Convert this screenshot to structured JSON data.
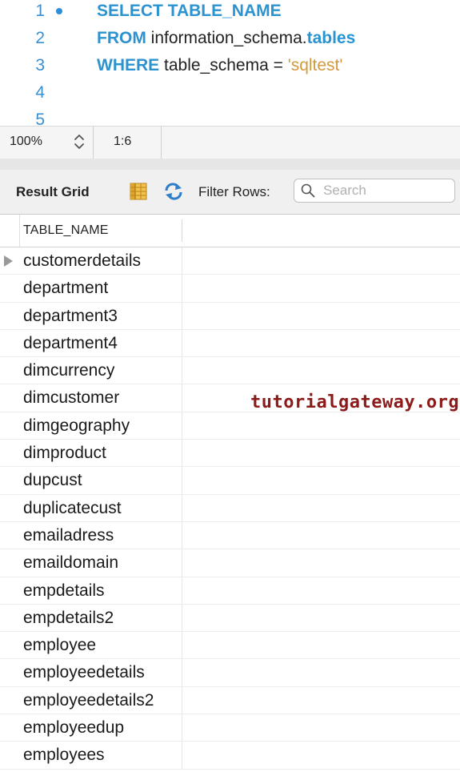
{
  "editor": {
    "lines": [
      {
        "number": "1",
        "keyword": "SELECT",
        "rest": " TABLE_NAME",
        "has_marker": true
      },
      {
        "number": "2",
        "keyword": "FROM",
        "rest": " information_schema.",
        "tail_keyword": "tables"
      },
      {
        "number": "3",
        "keyword": "WHERE",
        "rest": " table_schema = ",
        "string": "'sqltest'"
      },
      {
        "number": "4"
      },
      {
        "number": "5"
      }
    ]
  },
  "status": {
    "zoom": "100%",
    "cursor_position": "1:6"
  },
  "result_toolbar": {
    "title": "Result Grid",
    "filter_label": "Filter Rows:",
    "search_placeholder": "Search"
  },
  "grid": {
    "column_header": "TABLE_NAME",
    "rows": [
      "customerdetails",
      "department",
      "department3",
      "department4",
      "dimcurrency",
      "dimcustomer",
      "dimgeography",
      "dimproduct",
      "dupcust",
      "duplicatecust",
      "emailadress",
      "emaildomain",
      "empdetails",
      "empdetails2",
      "employee",
      "employeedetails",
      "employeedetails2",
      "employeedup",
      "employees"
    ]
  },
  "watermark": "tutorialgateway.org",
  "colors": {
    "keyword": "#2a93d0",
    "string": "#d39a3b",
    "line_number": "#3a8fd0",
    "watermark": "#8b1a1a"
  },
  "icons": {
    "marker": "breakpoint-dot-icon",
    "stepper": "chevron-up-down-icon",
    "grid": "result-grid-icon",
    "refresh": "refresh-arrows-icon",
    "search": "magnifier-icon",
    "row_pointer": "row-pointer-icon"
  }
}
